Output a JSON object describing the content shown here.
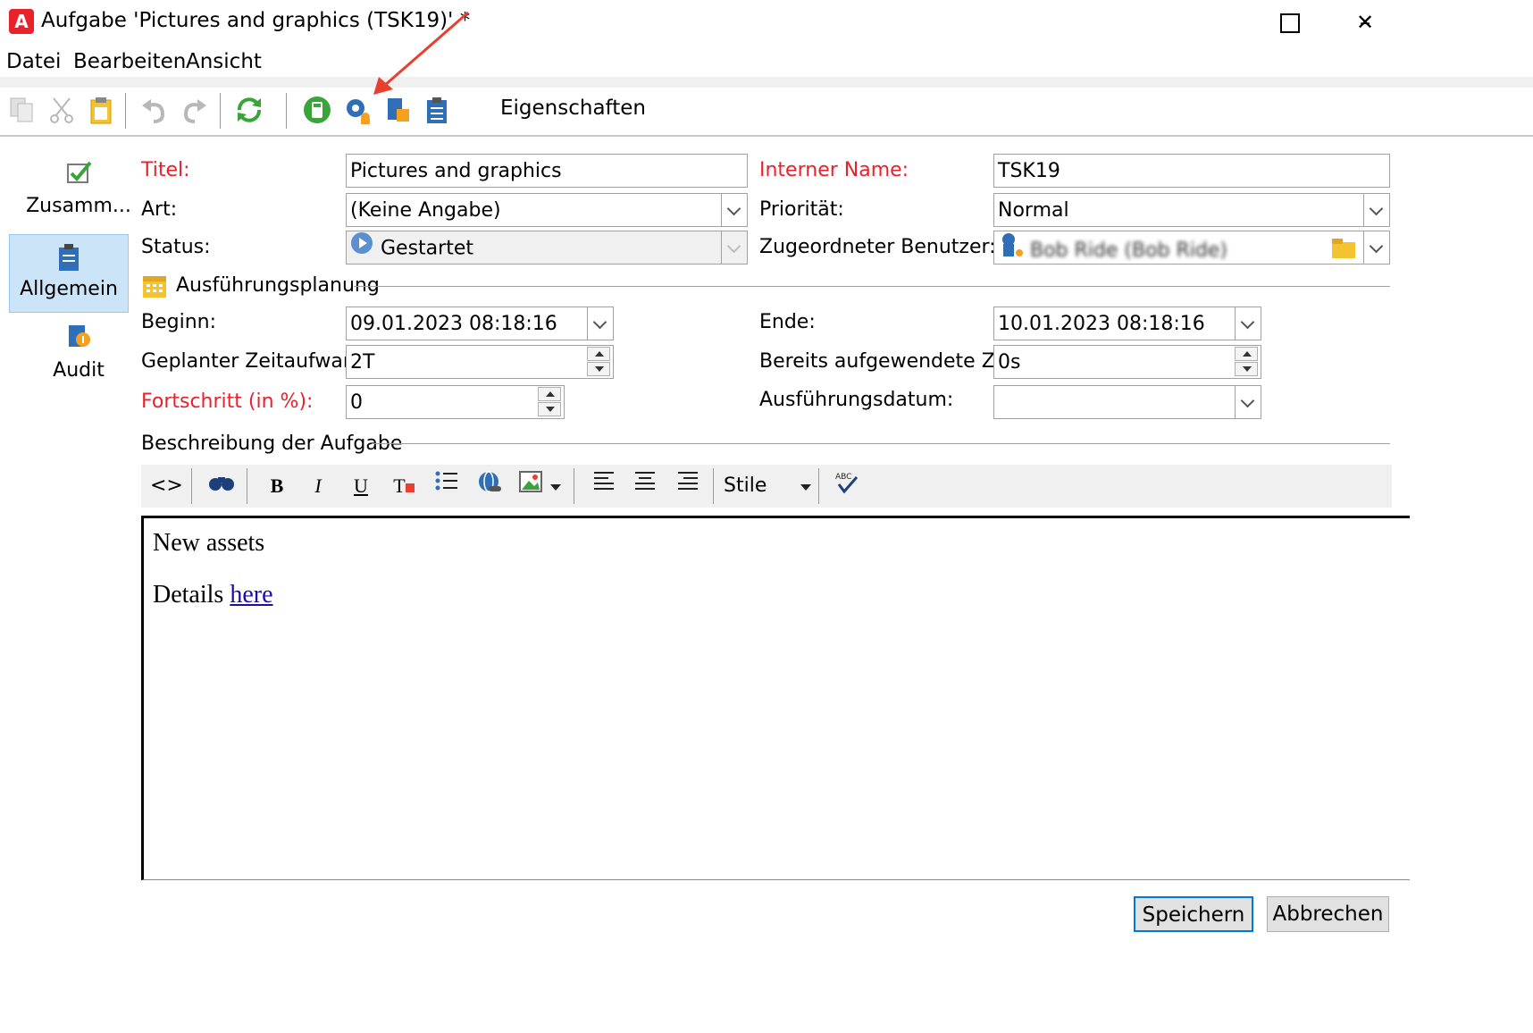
{
  "window": {
    "title": "Aufgabe 'Pictures and graphics (TSK19)' *",
    "logo": "A"
  },
  "menu": [
    "Datei",
    "Bearbeiten",
    "Ansicht"
  ],
  "toolbar": {
    "properties_label": "Eigenschaften"
  },
  "sidebar": {
    "items": [
      {
        "label": "Zusamm...",
        "icon": "checkbox-icon"
      },
      {
        "label": "Allgemein",
        "icon": "clipboard-icon"
      },
      {
        "label": "Audit",
        "icon": "audit-icon"
      }
    ]
  },
  "form": {
    "title_label": "Titel:",
    "title_value": "Pictures and graphics",
    "type_label": "Art:",
    "type_value": "(Keine Angabe)",
    "status_label": "Status:",
    "status_value": "Gestartet",
    "internal_name_label": "Interner Name:",
    "internal_name_value": "TSK19",
    "priority_label": "Priorität:",
    "priority_value": "Normal",
    "assigned_user_label": "Zugeordneter Benutzer:",
    "assigned_user_value": "Bob Ride (Bob Ride)"
  },
  "planning": {
    "section_label": "Ausführungsplanung",
    "start_label": "Beginn:",
    "start_value": "09.01.2023 08:18:16",
    "end_label": "Ende:",
    "end_value": "10.01.2023 08:18:16",
    "planned_effort_label": "Geplanter Zeitaufwand:",
    "planned_effort_value": "2T",
    "spent_time_label": "Bereits aufgewendete Zeit:",
    "spent_time_value": "0s",
    "progress_label": "Fortschritt (in %):",
    "progress_value": "0",
    "execution_date_label": "Ausführungsdatum:",
    "execution_date_value": ""
  },
  "description": {
    "section_label": "Beschreibung der Aufgabe",
    "style_label": "Stile",
    "line1": "New assets",
    "line2_prefix": "Details ",
    "link_text": "here"
  },
  "buttons": {
    "save": "Speichern",
    "cancel": "Abbrechen"
  },
  "colors": {
    "required_label": "#e8212b",
    "selected_sidebar": "#cce4f7",
    "annotation_arrow": "#e8402f"
  }
}
